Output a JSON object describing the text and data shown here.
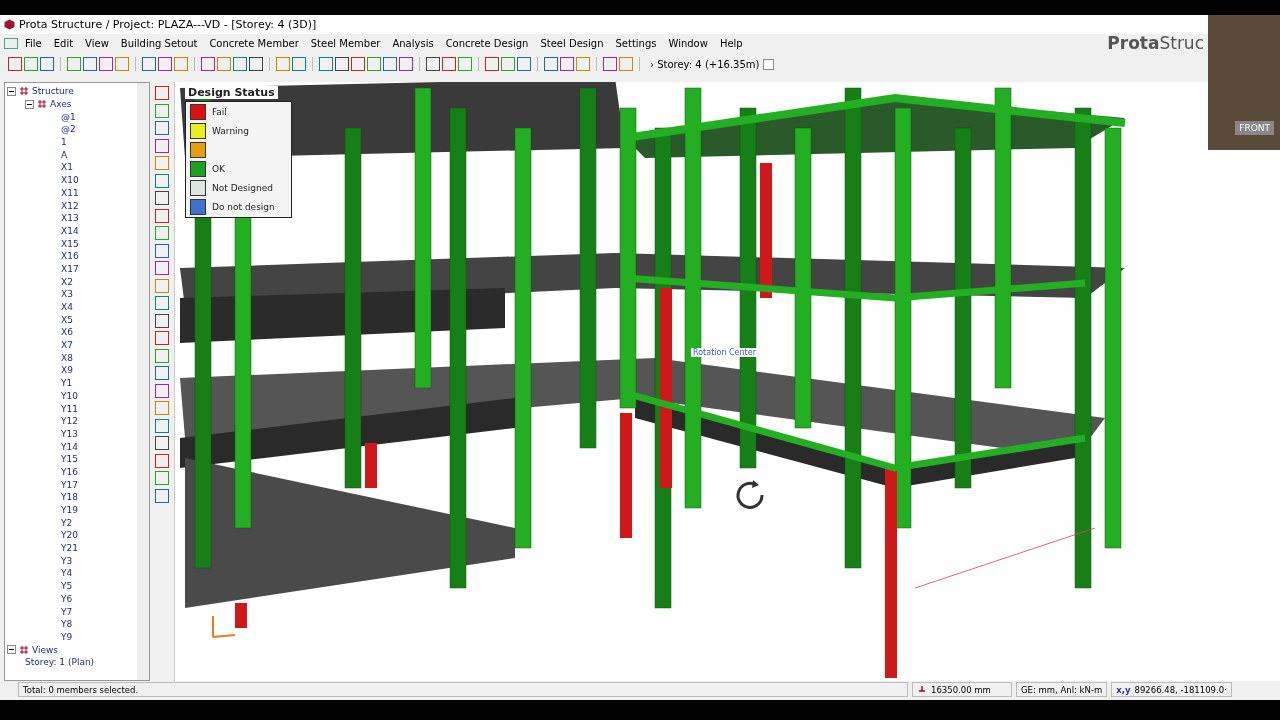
{
  "window": {
    "title": "Prota Structure / Project: PLAZA---VD - [Storey: 4 (3D)]"
  },
  "menu": [
    "File",
    "Edit",
    "View",
    "Building Setout",
    "Concrete Member",
    "Steel Member",
    "Analysis",
    "Concrete Design",
    "Steel Design",
    "Settings",
    "Window",
    "Help"
  ],
  "brand": {
    "bold": "Prota",
    "light": "Struc"
  },
  "storey_selector": {
    "prefix": "›",
    "value": "Storey: 4 (+16.35m)"
  },
  "tree": [
    {
      "label": "Structure",
      "expanded": true,
      "children": [
        {
          "label": "Axes",
          "expanded": true,
          "children": [
            {
              "label": "@1"
            },
            {
              "label": "@2"
            },
            {
              "label": "1"
            },
            {
              "label": "A"
            },
            {
              "label": "X1"
            },
            {
              "label": "X10"
            },
            {
              "label": "X11"
            },
            {
              "label": "X12"
            },
            {
              "label": "X13"
            },
            {
              "label": "X14"
            },
            {
              "label": "X15"
            },
            {
              "label": "X16"
            },
            {
              "label": "X17"
            },
            {
              "label": "X2"
            },
            {
              "label": "X3"
            },
            {
              "label": "X4"
            },
            {
              "label": "X5"
            },
            {
              "label": "X6"
            },
            {
              "label": "X7"
            },
            {
              "label": "X8"
            },
            {
              "label": "X9"
            },
            {
              "label": "Y1"
            },
            {
              "label": "Y10"
            },
            {
              "label": "Y11"
            },
            {
              "label": "Y12"
            },
            {
              "label": "Y13"
            },
            {
              "label": "Y14"
            },
            {
              "label": "Y15"
            },
            {
              "label": "Y16"
            },
            {
              "label": "Y17"
            },
            {
              "label": "Y18"
            },
            {
              "label": "Y19"
            },
            {
              "label": "Y2"
            },
            {
              "label": "Y20"
            },
            {
              "label": "Y21"
            },
            {
              "label": "Y3"
            },
            {
              "label": "Y4"
            },
            {
              "label": "Y5"
            },
            {
              "label": "Y6"
            },
            {
              "label": "Y7"
            },
            {
              "label": "Y8"
            },
            {
              "label": "Y9"
            }
          ]
        }
      ]
    },
    {
      "label": "Views",
      "expanded": true,
      "children": [
        {
          "label": "Storey: 1 (Plan)"
        }
      ]
    }
  ],
  "legend": {
    "title": "Design Status",
    "items": [
      {
        "label": "Fail",
        "color": "#e01010"
      },
      {
        "label": "Warning",
        "color": "#e8f020"
      },
      {
        "color": "#e0a010"
      },
      {
        "label": "OK",
        "color": "#20a020"
      },
      {
        "label": "Not Designed",
        "color": "#e0e4e0"
      },
      {
        "label": "Do not design",
        "color": "#4070d0"
      }
    ]
  },
  "viewport": {
    "rotation_label": "Rotation Center",
    "view_cube_label": "FRONT"
  },
  "status_bar": {
    "message": "Total: 0 members selected.",
    "elevation": "16350.00 mm",
    "units": "GE: mm,  Anl: kN-m",
    "coords_prefix": "x,y",
    "coords": "89266.48, -181109.0·"
  }
}
